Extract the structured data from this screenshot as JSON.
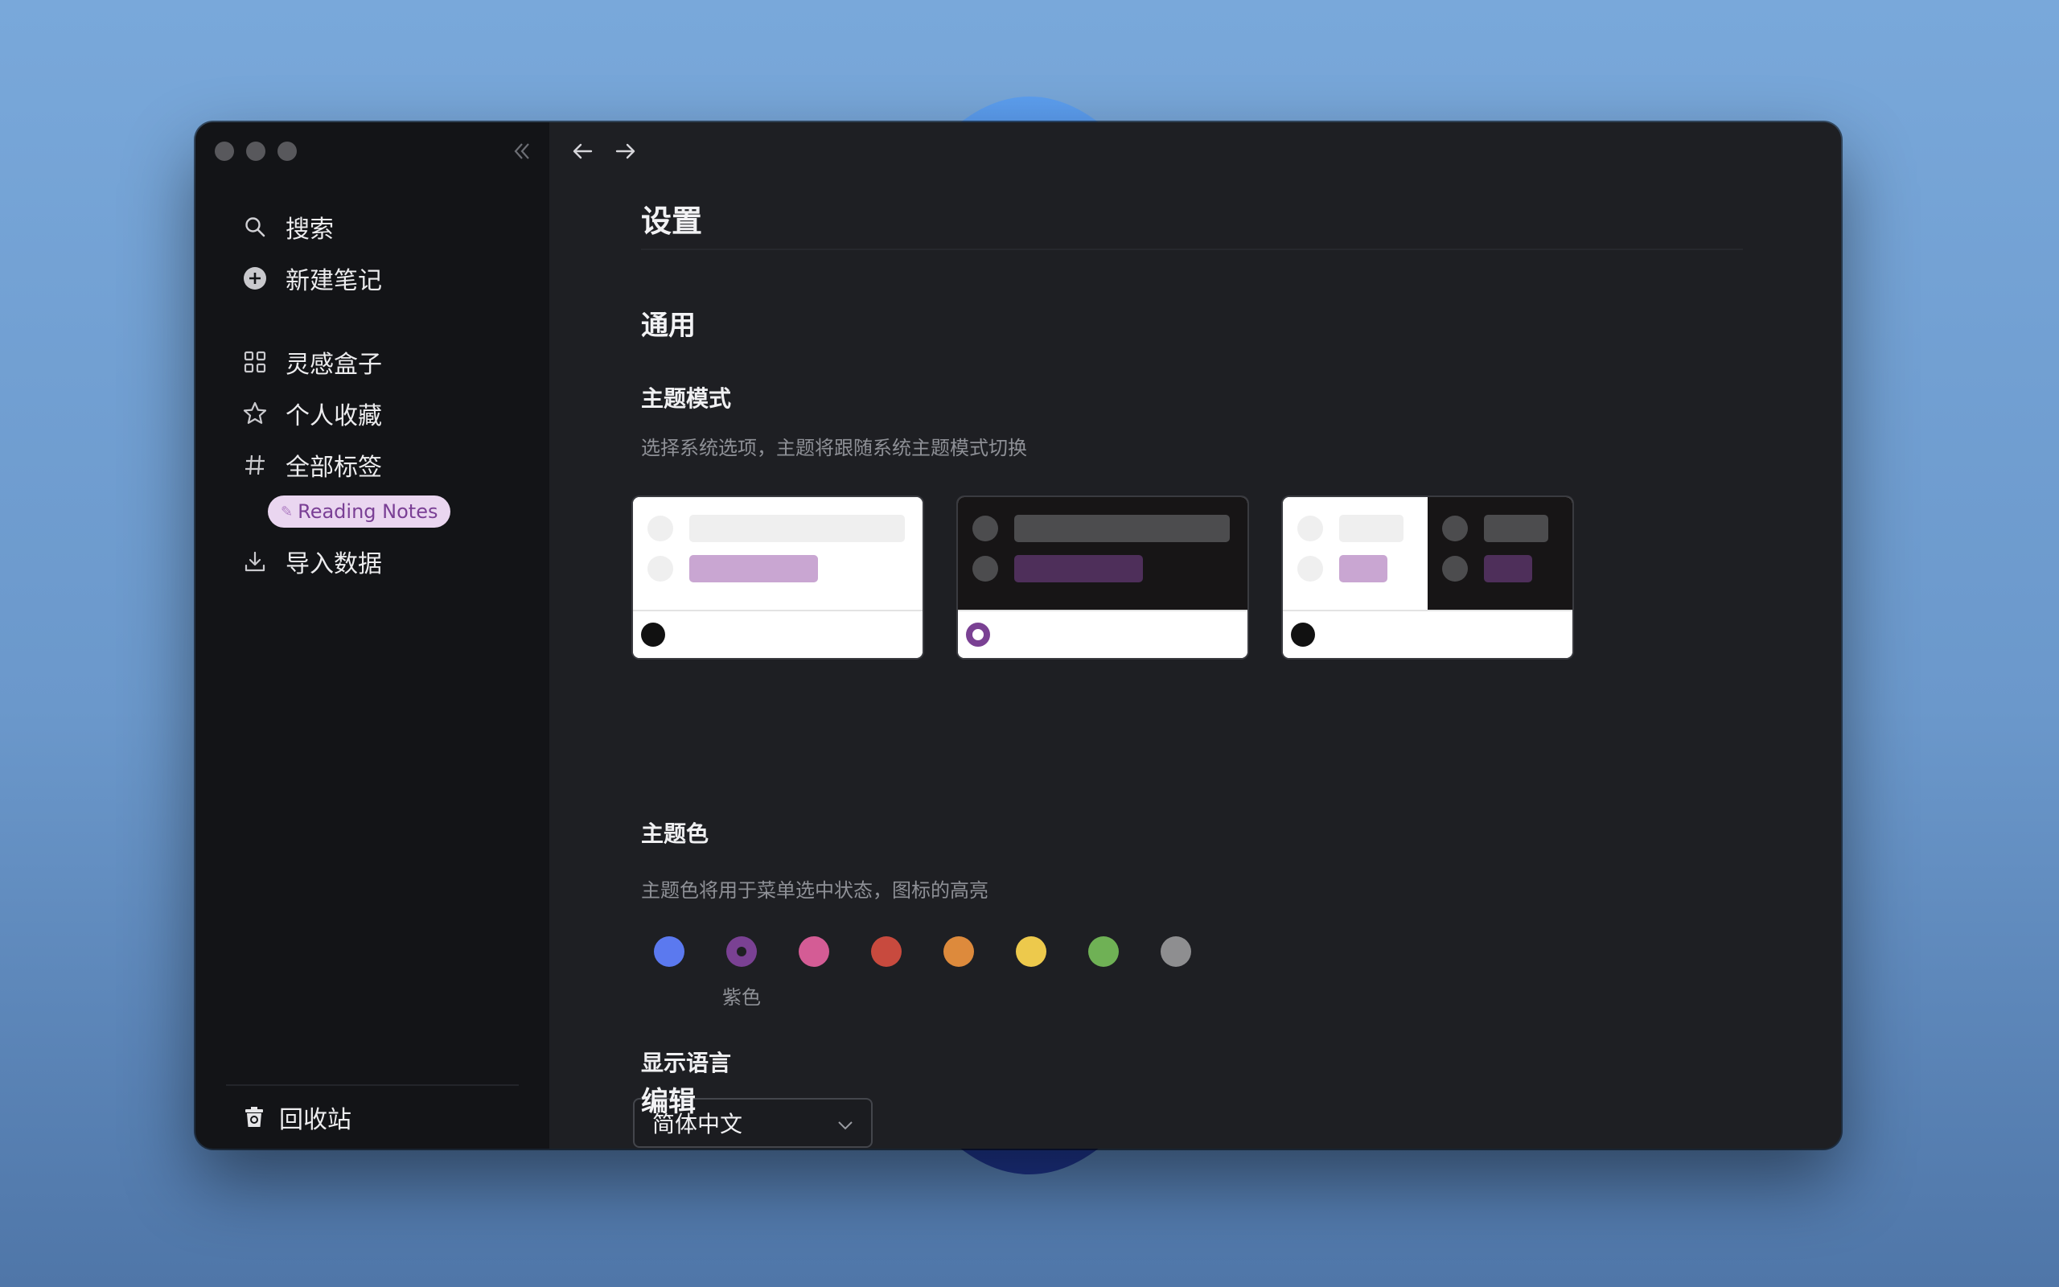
{
  "sidebar": {
    "items_top": [
      {
        "label": "搜索",
        "icon": "search-icon"
      },
      {
        "label": "新建笔记",
        "icon": "plus-circle-icon"
      }
    ],
    "items_main": [
      {
        "label": "灵感盒子",
        "icon": "grid-icon"
      },
      {
        "label": "个人收藏",
        "icon": "star-icon"
      },
      {
        "label": "全部标签",
        "icon": "hash-icon"
      }
    ],
    "tag": {
      "label": "Reading Notes",
      "icon": "pencil-icon"
    },
    "import": {
      "label": "导入数据",
      "icon": "download-icon"
    },
    "trash": {
      "label": "回收站",
      "icon": "trash-icon"
    }
  },
  "page": {
    "title": "设置",
    "section_general": "通用",
    "theme_mode": {
      "label": "主题模式",
      "description": "选择系统选项，主题将跟随系统主题模式切换",
      "options": [
        {
          "name": "light",
          "selected": false
        },
        {
          "name": "dark",
          "selected": true
        },
        {
          "name": "system",
          "selected": false
        }
      ]
    },
    "theme_color": {
      "label": "主题色",
      "description": "主题色将用于菜单选中状态，图标的高亮",
      "colors": [
        "#5b79ef",
        "#7a4193",
        "#d45c95",
        "#c84a3e",
        "#dd8a3c",
        "#edc94c",
        "#6fb155",
        "#8e8e90"
      ],
      "selected_index": 1,
      "selected_label": "紫色"
    },
    "language": {
      "label": "显示语言",
      "value": "简体中文"
    },
    "section_edit": "编辑"
  }
}
